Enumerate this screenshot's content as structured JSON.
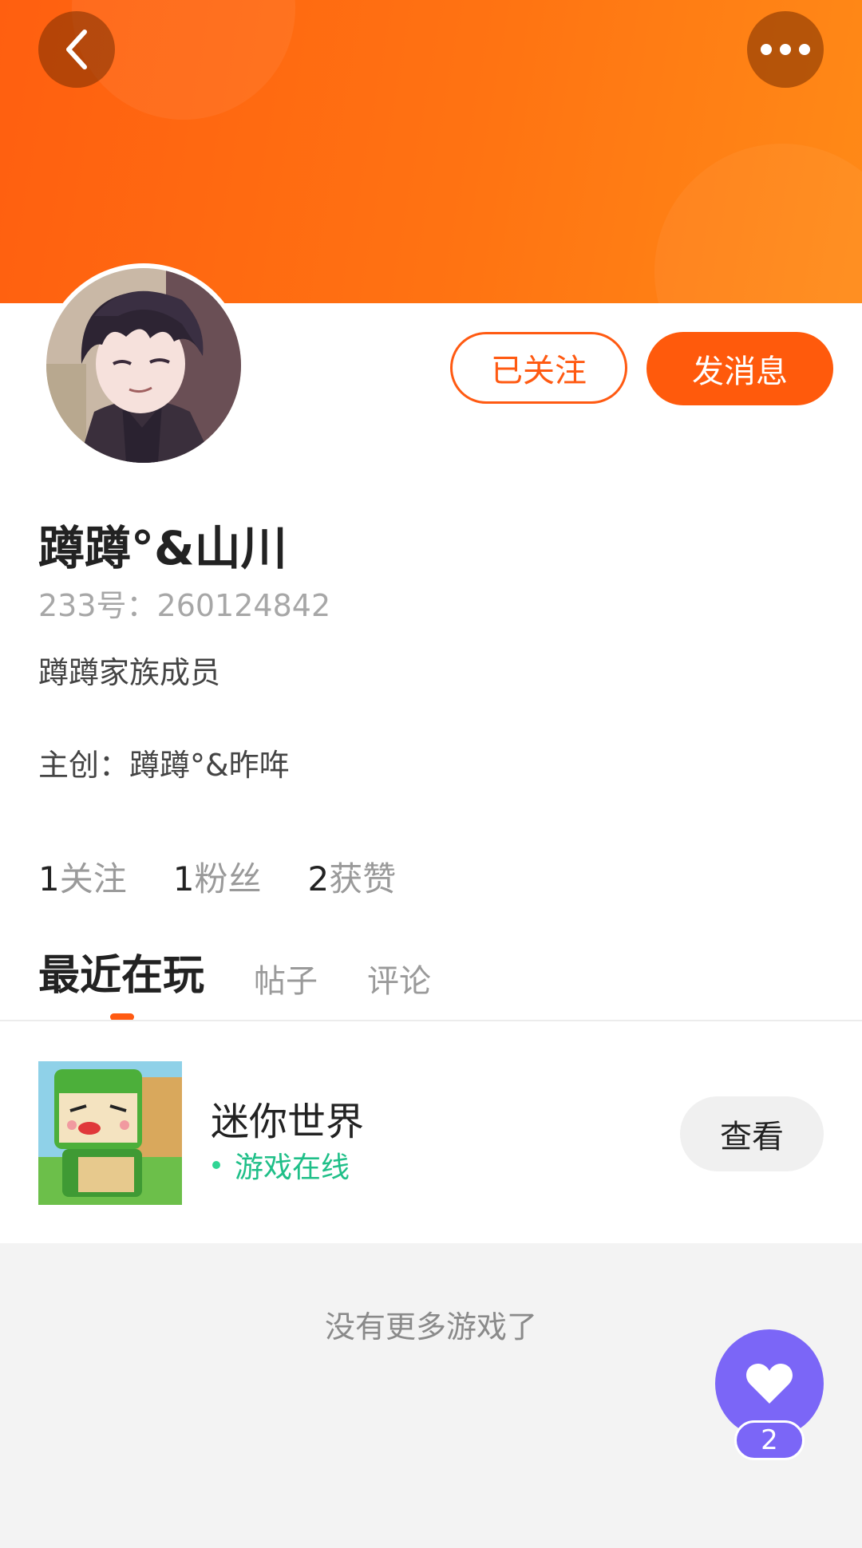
{
  "header": {
    "back_icon": "chevron-left-icon",
    "more_icon": "more-dots-icon",
    "colors": {
      "banner_start": "#ff5f10",
      "banner_end": "#ff8a17"
    }
  },
  "profile": {
    "nickname": "蹲蹲°&山川",
    "uid_text": "233号：260124842",
    "bio": "蹲蹲家族成员",
    "creator_line": "主创：蹲蹲°&昨哖",
    "followed_label": "已关注",
    "message_label": "发消息"
  },
  "stats": [
    {
      "num": "1",
      "label": "关注"
    },
    {
      "num": "1",
      "label": "粉丝"
    },
    {
      "num": "2",
      "label": "获赞"
    }
  ],
  "tabs": [
    {
      "label": "最近在玩",
      "active": true
    },
    {
      "label": "帖子",
      "active": false
    },
    {
      "label": "评论",
      "active": false
    }
  ],
  "game": {
    "title": "迷你世界",
    "status": "游戏在线",
    "view_label": "查看",
    "status_color": "#1fbf88"
  },
  "footer": {
    "no_more": "没有更多游戏了"
  },
  "like": {
    "icon": "heart-icon",
    "count": "2",
    "color": "#7b66f7"
  },
  "accent_color": "#ff5a12"
}
